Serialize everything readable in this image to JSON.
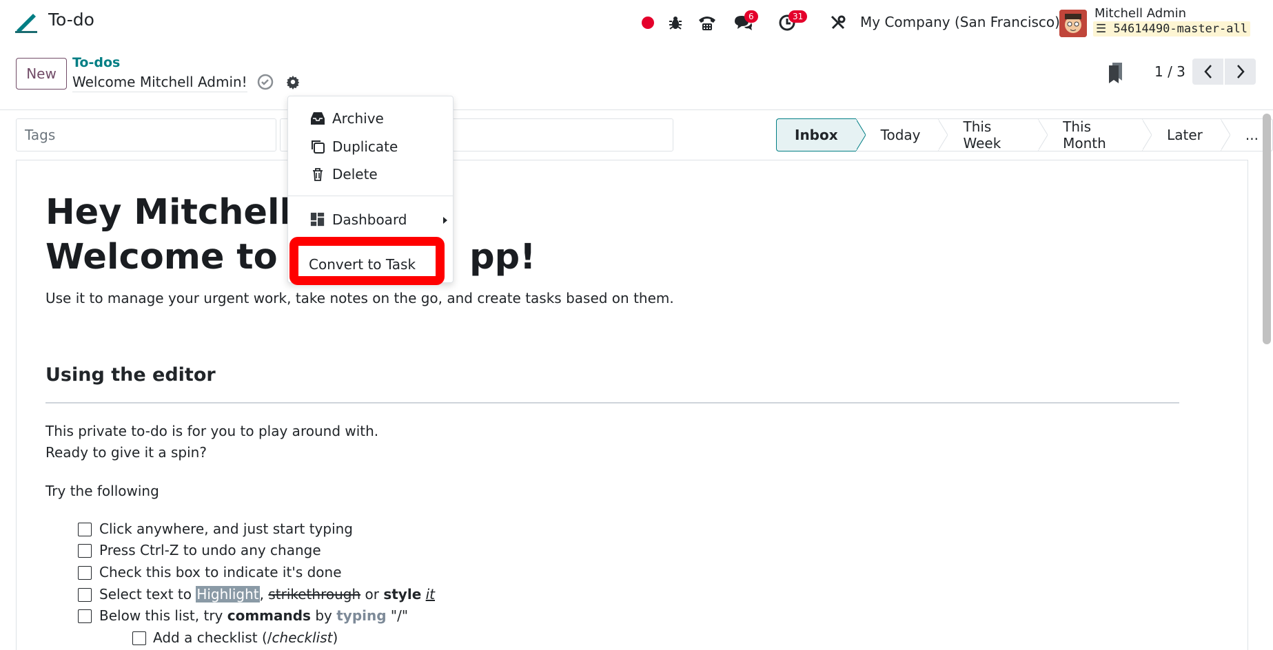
{
  "navbar": {
    "app_title": "To-do",
    "record_badge_count": "6",
    "activity_badge_count": "31",
    "company": "My Company (San Francisco)",
    "user_name": "Mitchell Admin",
    "database": "54614490-master-all",
    "icons": [
      "todo-logo-icon",
      "recording-dot-icon",
      "bug-icon",
      "phone-icon",
      "chat-icon",
      "clock-icon",
      "tools-icon"
    ]
  },
  "control_panel": {
    "new_label": "New",
    "breadcrumb_parent": "To-dos",
    "record_name": "Welcome Mitchell Admin!",
    "pager": "1 / 3"
  },
  "form": {
    "tags_placeholder": "Tags",
    "stages": [
      "Inbox",
      "Today",
      "This Week",
      "This Month",
      "Later",
      "..."
    ],
    "active_stage": "Inbox"
  },
  "content": {
    "heading_line1": "Hey Mitchell A",
    "heading_line2_a": "Welcome to th",
    "heading_line2_b": "pp!",
    "intro_a": "Use it to manage your urgent work, ",
    "intro_b": "take notes on the go, and create tasks based on them.",
    "section_title": "Using the editor",
    "para1": "This private to-do is for you to play around with.",
    "para2": "Ready to give it a spin?",
    "para3": "Try the following",
    "checklist": [
      "Click anywhere, and just start typing",
      "Press Ctrl-Z to undo any change",
      "Check this box to indicate it's done"
    ],
    "item4": {
      "pre": "Select text to ",
      "highlight": "Highlight",
      "comma": ", ",
      "strike": "strikethrough",
      "or": " or ",
      "style": "style",
      "it": "it"
    },
    "item5": {
      "pre": "Below this list, try ",
      "commands": "commands",
      "by": " by ",
      "typing": "typing",
      "slash": " \"/\""
    },
    "subitem": {
      "pre": "Add a checklist (/",
      "checklist": "checklist",
      "post": ")"
    }
  },
  "dropdown": {
    "archive": "Archive",
    "duplicate": "Duplicate",
    "delete": "Delete",
    "dashboard": "Dashboard",
    "convert": "Convert to Task"
  },
  "colors": {
    "brand": "#714b67",
    "teal": "#017e84",
    "highlight": "#ff0000",
    "badge": "#e4002b"
  }
}
